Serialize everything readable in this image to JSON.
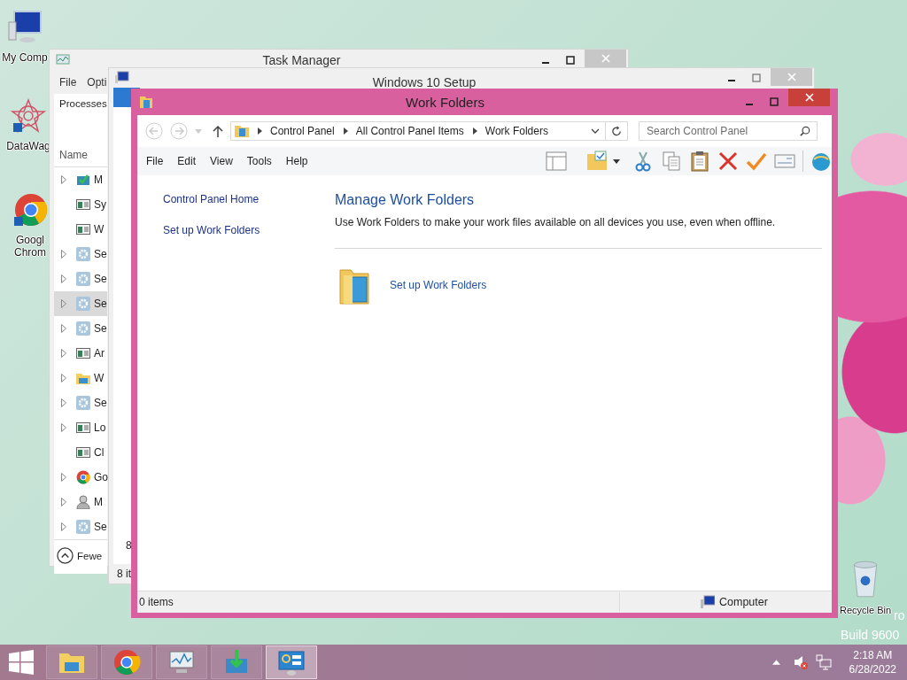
{
  "desktop": {
    "icons": [
      {
        "kind": "computer",
        "lines": [
          "My Comp"
        ]
      },
      {
        "kind": "star",
        "lines": [
          "DataWag"
        ]
      },
      {
        "kind": "chrome",
        "lines": [
          "Googl",
          "Chrom"
        ]
      }
    ],
    "recycle_bin": {
      "label": "Recycle Bin"
    },
    "os_text": [
      "ro",
      "Build 9600"
    ]
  },
  "task_manager": {
    "title": "Task Manager",
    "menu": [
      "File",
      "Opti"
    ],
    "tab": "Processes",
    "column": "Name",
    "rows": [
      {
        "name": "M",
        "kind": "setup",
        "expandable": true,
        "selected": false
      },
      {
        "name": "Sy",
        "kind": "app",
        "expandable": false,
        "selected": false
      },
      {
        "name": "W",
        "kind": "app",
        "expandable": false,
        "selected": false
      },
      {
        "name": "Se",
        "kind": "gear",
        "expandable": true,
        "selected": false
      },
      {
        "name": "Se",
        "kind": "gear",
        "expandable": true,
        "selected": false
      },
      {
        "name": "Se",
        "kind": "gear",
        "expandable": true,
        "selected": true
      },
      {
        "name": "Se",
        "kind": "gear",
        "expandable": true,
        "selected": false
      },
      {
        "name": "Ar",
        "kind": "app",
        "expandable": true,
        "selected": false
      },
      {
        "name": "W",
        "kind": "folder",
        "expandable": true,
        "selected": false
      },
      {
        "name": "Se",
        "kind": "gear",
        "expandable": true,
        "selected": false
      },
      {
        "name": "Lo",
        "kind": "app",
        "expandable": true,
        "selected": false
      },
      {
        "name": "Cl",
        "kind": "app",
        "expandable": false,
        "selected": false
      },
      {
        "name": "Go",
        "kind": "chrome",
        "expandable": true,
        "selected": false
      },
      {
        "name": "M",
        "kind": "user",
        "expandable": true,
        "selected": false
      },
      {
        "name": "Se",
        "kind": "gear",
        "expandable": true,
        "selected": false
      }
    ],
    "footer": "Fewe"
  },
  "setup_window": {
    "title": "Windows 10 Setup",
    "text": "8",
    "status": "8 it"
  },
  "work_folders": {
    "title": "Work Folders",
    "breadcrumbs": [
      "Control Panel",
      "All Control Panel Items",
      "Work Folders"
    ],
    "search": {
      "placeholder": "Search Control Panel"
    },
    "menu": [
      "File",
      "Edit",
      "View",
      "Tools",
      "Help"
    ],
    "nav_links": [
      "Control Panel Home",
      "Set up Work Folders"
    ],
    "heading": "Manage Work Folders",
    "description": "Use Work Folders to make your work files available on all devices you use, even when offline.",
    "task_link": "Set up Work Folders",
    "status": {
      "items": "0 items",
      "zone": "Computer"
    }
  },
  "taskbar": {
    "buttons": [
      {
        "kind": "explorer",
        "selected": false
      },
      {
        "kind": "chrome",
        "selected": false
      },
      {
        "kind": "monitor",
        "selected": false
      },
      {
        "kind": "setup",
        "selected": false
      },
      {
        "kind": "control-panel",
        "selected": true
      }
    ],
    "clock": {
      "time": "2:18 AM",
      "date": "6/28/2022"
    }
  }
}
